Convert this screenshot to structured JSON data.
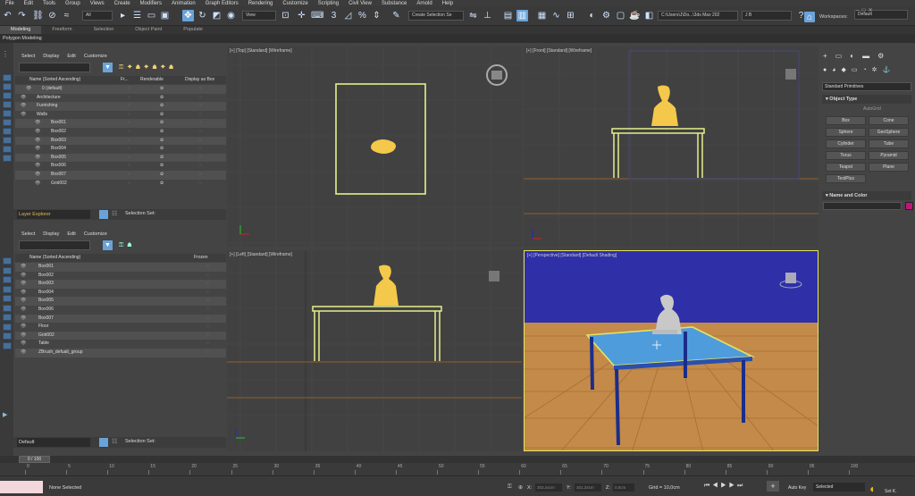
{
  "menu": [
    "File",
    "Edit",
    "Tools",
    "Group",
    "Views",
    "Create",
    "Modifiers",
    "Animation",
    "Graph Editors",
    "Rendering",
    "Customize",
    "Scripting",
    "Civil View",
    "Substance",
    "Arnold",
    "Help"
  ],
  "user": "J B",
  "workspaces_label": "Workspaces:",
  "workspace_value": "Default",
  "toolbar": {
    "filter_value": "All",
    "coord_value": "View",
    "selection_set": "Create Selection Se",
    "path": "C:\\Users\\J\\Do...\\3ds Max 202"
  },
  "ribbon_tabs": [
    "Modeling",
    "Freeform",
    "Selection",
    "Object Paint",
    "Populate"
  ],
  "ribbon_sub": "Polygon Modeling",
  "scene_menu": [
    "Select",
    "Display",
    "Edit",
    "Customize"
  ],
  "layers_header": {
    "name": "Name (Sorted Ascending)",
    "fr": "Fr...",
    "renderable": "Renderable",
    "display_box": "Display as Box"
  },
  "layers": [
    "0 (default)",
    "Architecture",
    "Furnishing",
    "Walls",
    "Box001",
    "Box002",
    "Box003",
    "Box004",
    "Box005",
    "Box006",
    "Box007",
    "Grid002"
  ],
  "explorer1": {
    "name": "Layer Explorer",
    "selection_set": "Selection Set:"
  },
  "objects_header": {
    "name": "Name (Sorted Ascending)",
    "frozen": "Frozen"
  },
  "objects": [
    "Box001",
    "Box002",
    "Box003",
    "Box004",
    "Box005",
    "Box006",
    "Box007",
    "Floor",
    "Grid002",
    "Table",
    "ZBrush_defualt_group"
  ],
  "explorer2": {
    "name": "Default",
    "selection_set": "Selection Set:"
  },
  "viewports": {
    "top": "[+] [Top] [Standard] [Wireframe]",
    "front": "[+] [Front] [Standard] [Wireframe]",
    "left": "[+] [Left] [Standard] [Wireframe]",
    "perspective": "[+] [Perspective] [Standard] [Default Shading]"
  },
  "command_panel": {
    "dropdown": "Standard Primitives",
    "object_type": "Object Type",
    "autogrid": "AutoGrid",
    "buttons": [
      "Box",
      "Cone",
      "Sphere",
      "GeoSphere",
      "Cylinder",
      "Tube",
      "Torus",
      "Pyramid",
      "Teapot",
      "Plane",
      "TextPlus"
    ],
    "name_color": "Name and Color"
  },
  "timeline": {
    "frame": "0 / 100",
    "ticks": [
      "0",
      "5",
      "10",
      "15",
      "20",
      "25",
      "30",
      "35",
      "40",
      "45",
      "50",
      "55",
      "60",
      "65",
      "70",
      "75",
      "80",
      "85",
      "90",
      "95",
      "100"
    ]
  },
  "status": {
    "none_selected": "None Selected",
    "x_label": "X:",
    "x_value": "303,44cm",
    "y_label": "Y:",
    "y_value": "301,34cm",
    "z_label": "Z:",
    "z_value": "0,0cm",
    "grid": "Grid = 10,0cm",
    "autokey": "Auto Key",
    "selected": "Selected",
    "setkey": "Set K."
  }
}
